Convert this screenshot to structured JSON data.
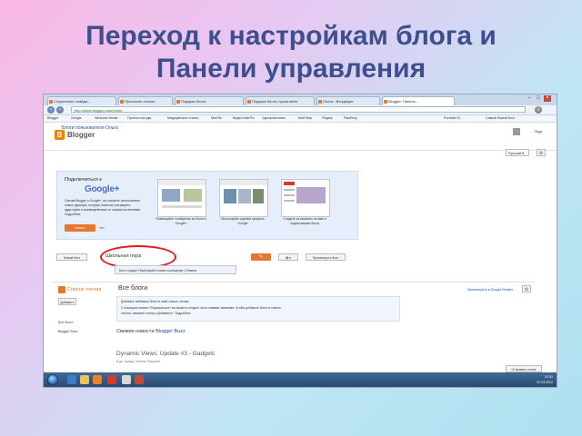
{
  "slide": {
    "title_line1": "Переход к настройкам блога и",
    "title_line2": "Панели управления"
  },
  "browser": {
    "tabs": [
      "Сохранение слайда...",
      "Прочитать статью",
      "Подарки блога",
      "Подарок блога, прочитайте",
      "Почта - Входящие",
      "Blogger: Панель..."
    ],
    "url": "http://www.blogger.com/home",
    "bookmarks": [
      "Blogger",
      "Google",
      "Windows Media",
      "Прогноз погоды",
      "Медицинские статьи",
      "Mail.Ru",
      "Видео Mail.Ru",
      "Одноклассники",
      "Мой Мир",
      "Яндекс",
      "Рамблер",
      "Portable Bl...",
      "Самый Новый Блог"
    ]
  },
  "header": {
    "brand": "Blogger",
    "user_name": "Olga",
    "blogs_label": "Блоги пользователя Ольга",
    "language": "Русский"
  },
  "promo": {
    "title": "Подключиться к",
    "google": "Google+",
    "text": "Связав Blogger с Google+, вы сможете использовать новые функции, которые позволят расширить аудиторию и взаимодействие со своими читателями. Подробнее",
    "primary_button": "Начать использование",
    "secondary_button": "Нет",
    "captions": [
      "Размещайте сообщения из блога в Google+",
      "Используйте единый профиль Google",
      "Следите за вашими гостями и подписчиками блога"
    ]
  },
  "blog_row": {
    "new_blog_button": "Новый блог",
    "blog_name": "Школьная пора",
    "view_blog_button": "Просмотреть блог",
    "tooltip": "Блог создан! Опубликуйте новое сообщение | Отмена"
  },
  "reading_list": {
    "title": "Список чтения",
    "heading": "Все блоги",
    "view_reader": "Просмотреть в Google Reader",
    "add_button": "Добавить",
    "side_links": [
      "Все блоги",
      "Blogger Buzz"
    ],
    "add_box_lines": [
      "Добавьте любимые блоги в свой список чтения",
      "С помощью кнопки «Подписаться» вы можете следить за их новыми записями. Чтобы добавить блоги в список",
      "чтения, нажмите кнопку «Добавить». Подробнее"
    ],
    "news_prefix": "Свежие новости",
    "news_link": "Blogger Buzz",
    "post_title": "Dynamic Views: Update #3 - Gadgets",
    "post_meta": "6 дн. назад. Pauline Pasquier",
    "feedback_button": "Отправить отзыв"
  },
  "taskbar": {
    "time": "22:51",
    "date": "22.03.2012"
  }
}
